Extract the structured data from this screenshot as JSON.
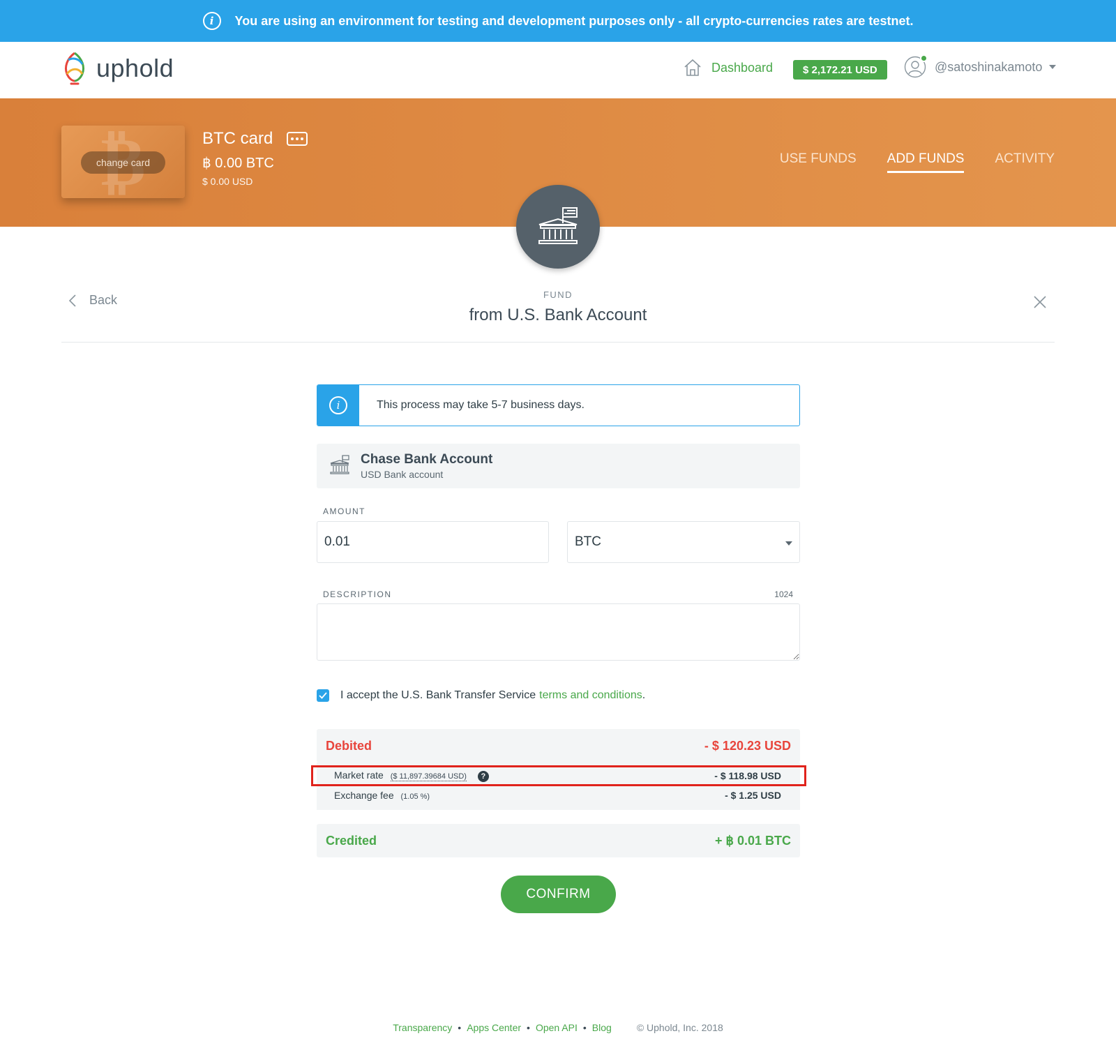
{
  "banner": {
    "text": "You are using an environment for testing and development purposes only - all crypto-currencies rates are testnet."
  },
  "topnav": {
    "logo_text": "uphold",
    "dashboard_label": "Dashboard",
    "balance": "$ 2,172.21 USD",
    "username": "@satoshinakamoto"
  },
  "card": {
    "change_label": "change card",
    "name": "BTC card",
    "balance": "฿ 0.00 BTC",
    "balance_usd": "$ 0.00 USD",
    "tabs": [
      {
        "label": "USE FUNDS",
        "active": false
      },
      {
        "label": "ADD FUNDS",
        "active": true
      },
      {
        "label": "ACTIVITY",
        "active": false
      }
    ]
  },
  "subheader": {
    "back_label": "Back",
    "eyebrow": "FUND",
    "title": "from U.S. Bank Account"
  },
  "form": {
    "info_message": "This process may take 5-7 business days.",
    "bank_name": "Chase Bank Account",
    "bank_sub": "USD Bank account",
    "amount_label": "AMOUNT",
    "amount_value": "0.01",
    "currency_value": "BTC",
    "description_label": "DESCRIPTION",
    "description_count": "1024",
    "description_value": "",
    "accept_text": "I accept the U.S. Bank Transfer Service",
    "terms_link": "terms and conditions",
    "accept_period": ".",
    "accepted": true
  },
  "summary": {
    "debited_label": "Debited",
    "debited_amount": "- $ 120.23 USD",
    "market_rate_label": "Market rate",
    "market_rate_detail": "($ 11,897.39684 USD)",
    "market_rate_amount": "- $ 118.98 USD",
    "fee_label": "Exchange fee",
    "fee_detail": "(1.05 %)",
    "fee_amount": "- $ 1.25 USD",
    "credited_label": "Credited",
    "credited_amount": "+ ฿ 0.01 BTC",
    "help_glyph": "?"
  },
  "confirm_label": "CONFIRM",
  "footer": {
    "links": [
      "Transparency",
      "Apps Center",
      "Open API",
      "Blog"
    ],
    "separator": "•",
    "copyright": "© Uphold, Inc. 2018"
  },
  "colors": {
    "info_blue": "#2aa3e8",
    "brand_green": "#49a84a",
    "card_orange": "#d9803a",
    "debit_red": "#e8453c",
    "highlight_red": "#e0231c"
  }
}
